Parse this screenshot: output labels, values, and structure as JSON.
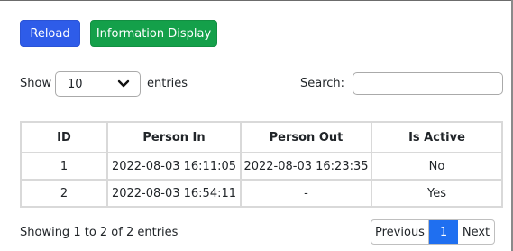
{
  "toolbar": {
    "reload_label": "Reload",
    "info_label": "Information Display"
  },
  "length": {
    "show_label": "Show",
    "selected": "10",
    "suffix": "entries"
  },
  "search": {
    "label": "Search:",
    "value": ""
  },
  "table": {
    "headers": [
      "ID",
      "Person In",
      "Person Out",
      "Is Active"
    ],
    "rows": [
      [
        "1",
        "2022-08-03 16:11:05",
        "2022-08-03 16:23:35",
        "No"
      ],
      [
        "2",
        "2022-08-03 16:54:11",
        "-",
        "Yes"
      ]
    ]
  },
  "footer": {
    "info": "Showing 1 to 2 of 2 entries",
    "prev_label": "Previous",
    "current_page": "1",
    "next_label": "Next"
  },
  "colors": {
    "reload": "#2e5ce9",
    "info": "#14a04a",
    "page_active": "#1f6ff0"
  },
  "icons": {
    "select_arrow": "chevron-down-icon"
  }
}
